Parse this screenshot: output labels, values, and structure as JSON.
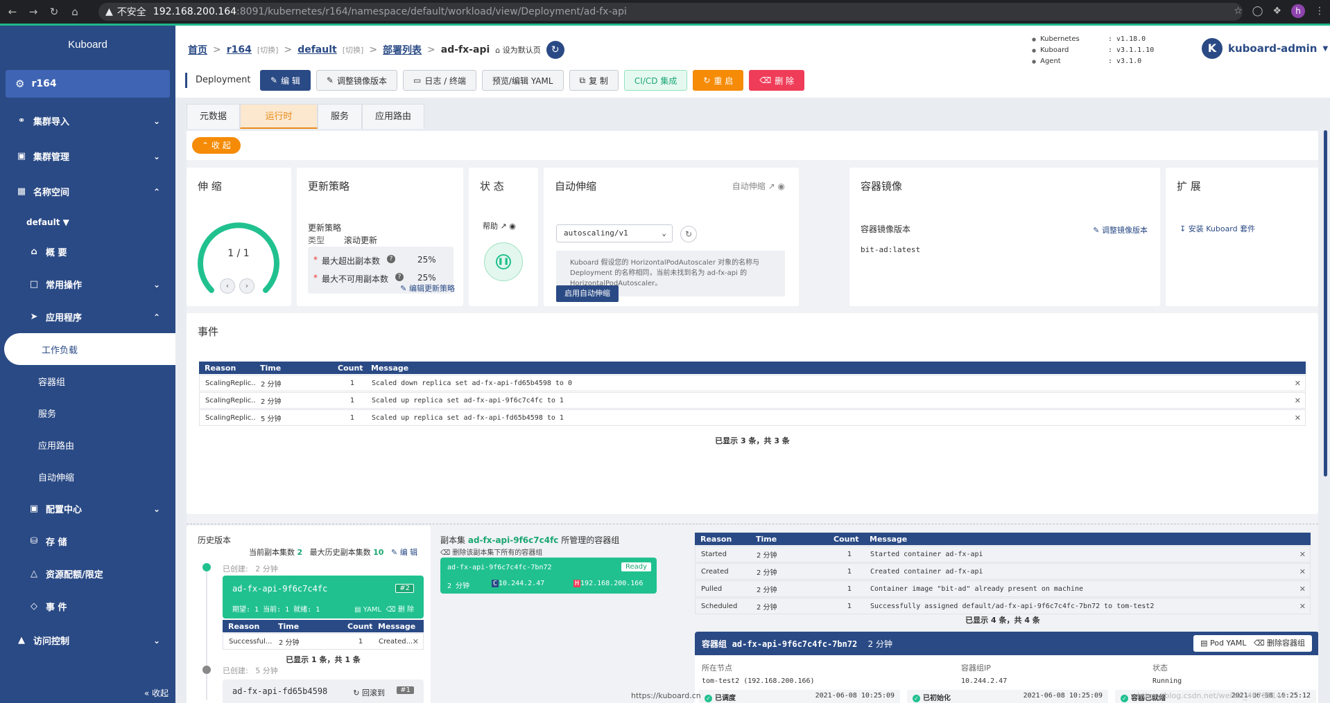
{
  "browser": {
    "insecure": "不安全",
    "host": "192.168.200.164",
    "path": ":8091/kubernetes/r164/namespace/default/workload/view/Deployment/ad-fx-api",
    "profile": "h"
  },
  "sidebar": {
    "brand": "Kuboard",
    "cluster": "r164",
    "items": {
      "import": "集群导入",
      "manage": "集群管理",
      "ns": "名称空间",
      "ns_name": "default",
      "overview": "概 要",
      "ops": "常用操作",
      "apps": "应用程序",
      "workload": "工作负载",
      "pods": "容器组",
      "svc": "服务",
      "ingress": "应用路由",
      "hpa": "自动伸缩",
      "config": "配置中心",
      "storage": "存 储",
      "quota": "资源配额/限定",
      "events": "事 件",
      "access": "访问控制"
    },
    "collapse": "收起"
  },
  "breadcrumb": {
    "home": "首页",
    "cluster": "r164",
    "switch": "[切换]",
    "ns": "default",
    "list": "部署列表",
    "current": "ad-fx-api",
    "set_default": "设为默认页"
  },
  "versions": [
    {
      "k": "Kubernetes",
      "v": ": v1.18.0"
    },
    {
      "k": "Kuboard",
      "v": ": v3.1.1.10"
    },
    {
      "k": "Agent",
      "v": ": v3.1.0"
    }
  ],
  "user": {
    "initial": "K",
    "name": "kuboard-admin"
  },
  "actions": {
    "kind": "Deployment",
    "edit": "编 辑",
    "image": "调整镜像版本",
    "logs": "日志 / 终端",
    "yaml": "预览/编辑 YAML",
    "copy": "复 制",
    "cicd": "CI/CD 集成",
    "restart": "重 启",
    "delete": "删 除"
  },
  "tabs": [
    "元数据",
    "运行时",
    "服务",
    "应用路由"
  ],
  "collapse_btn": "收 起",
  "scale": {
    "title": "伸 缩",
    "value": "1 / 1"
  },
  "strategy": {
    "title": "更新策略",
    "label": "更新策略",
    "type_k": "类型",
    "type_v": "滚动更新",
    "surge_k": "最大超出副本数",
    "surge_v": "25%",
    "unavail_k": "最大不可用副本数",
    "unavail_v": "25%",
    "edit": "编辑更新策略"
  },
  "status": {
    "title": "状 态",
    "help": "帮助"
  },
  "autoscale": {
    "title": "自动伸缩",
    "link": "自动伸缩",
    "select": "autoscaling/v1",
    "info": "Kuboard 假设您的 HorizontalPodAutoscaler 对象的名称与 Deployment 的名称相同，当前未找到名为 ad-fx-api 的 HorizontalPodAutoscaler。",
    "enable": "启用自动伸缩"
  },
  "image": {
    "title": "容器镜像",
    "label": "容器镜像版本",
    "adjust": "调整镜像版本",
    "value": "bit-ad:latest"
  },
  "ext": {
    "title": "扩 展",
    "install": "安装 Kuboard 套件"
  },
  "events": {
    "title": "事件",
    "headers": [
      "Reason",
      "Time",
      "Count",
      "Message"
    ],
    "rows": [
      {
        "reason": "ScalingReplic...",
        "time": "2 分钟",
        "count": "1",
        "msg": "Scaled down replica set ad-fx-api-fd65b4598 to 0"
      },
      {
        "reason": "ScalingReplic...",
        "time": "2 分钟",
        "count": "1",
        "msg": "Scaled up replica set ad-fx-api-9f6c7c4fc to 1"
      },
      {
        "reason": "ScalingReplic...",
        "time": "5 分钟",
        "count": "1",
        "msg": "Scaled up replica set ad-fx-api-fd65b4598 to 1"
      }
    ],
    "footer": "已显示 3 条，共 3 条"
  },
  "history": {
    "title": "历史版本",
    "cur_label": "当前副本集数",
    "cur_val": "2",
    "max_label": "最大历史副本集数",
    "max_val": "10",
    "edit": "编 辑",
    "created": "已创建:",
    "rs1": {
      "age": "2 分钟",
      "name": "ad-fx-api-9f6c7c4fc",
      "rev": "#2",
      "stats": "期望: 1 当前: 1 就绪: 1",
      "yaml": "YAML",
      "del": "删 除"
    },
    "rs1_event": {
      "reason": "Successful...",
      "time": "2 分钟",
      "count": "1",
      "msg": "Created..."
    },
    "rs1_footer": "已显示 1 条，共 1 条",
    "rs2": {
      "age": "5 分钟",
      "name": "ad-fx-api-fd65b4598",
      "rollback": "回滚到",
      "rev": "#1"
    }
  },
  "rsview": {
    "prefix": "副本集",
    "rs": "ad-fx-api-9f6c7c4fc",
    "suffix": "所管理的容器组",
    "delete_all": "删除该副本集下所有的容器组",
    "pod": {
      "name": "ad-fx-api-9f6c7c4fc-7bn72",
      "ready": "Ready",
      "age": "2 分钟",
      "cip": "10.244.2.47",
      "hip": "192.168.200.166"
    }
  },
  "podevents": {
    "headers": [
      "Reason",
      "Time",
      "Count",
      "Message"
    ],
    "rows": [
      {
        "reason": "Started",
        "time": "2 分钟",
        "count": "1",
        "msg": "Started container ad-fx-api"
      },
      {
        "reason": "Created",
        "time": "2 分钟",
        "count": "1",
        "msg": "Created container ad-fx-api"
      },
      {
        "reason": "Pulled",
        "time": "2 分钟",
        "count": "1",
        "msg": "Container image \"bit-ad\" already present on machine"
      },
      {
        "reason": "Scheduled",
        "time": "2 分钟",
        "count": "1",
        "msg": "Successfully assigned default/ad-fx-api-9f6c7c4fc-7bn72 to tom-test2"
      }
    ],
    "footer": "已显示 4 条，共 4 条"
  },
  "pod": {
    "label": "容器组",
    "name": "ad-fx-api-9f6c7c4fc-7bn72",
    "age": "2 分钟",
    "yaml": "Pod YAML",
    "del": "删除容器组",
    "node_k": "所在节点",
    "node_v": "tom-test2 (192.168.200.166)",
    "ip_k": "容器组IP",
    "ip_v": "10.244.2.47",
    "st_k": "状态",
    "st_v": "Running",
    "c1": "已调度",
    "t1": "2021-06-08 10:25:09",
    "c2": "已初始化",
    "t2": "2021-06-08 10:25:09",
    "c3": "容器已就绪",
    "t3": "2021-06-08 10:25:12"
  },
  "statusbar": {
    "url": "https://kuboard.cn",
    "watermark": "https://blog.csdn.net/weixin_46785144"
  }
}
